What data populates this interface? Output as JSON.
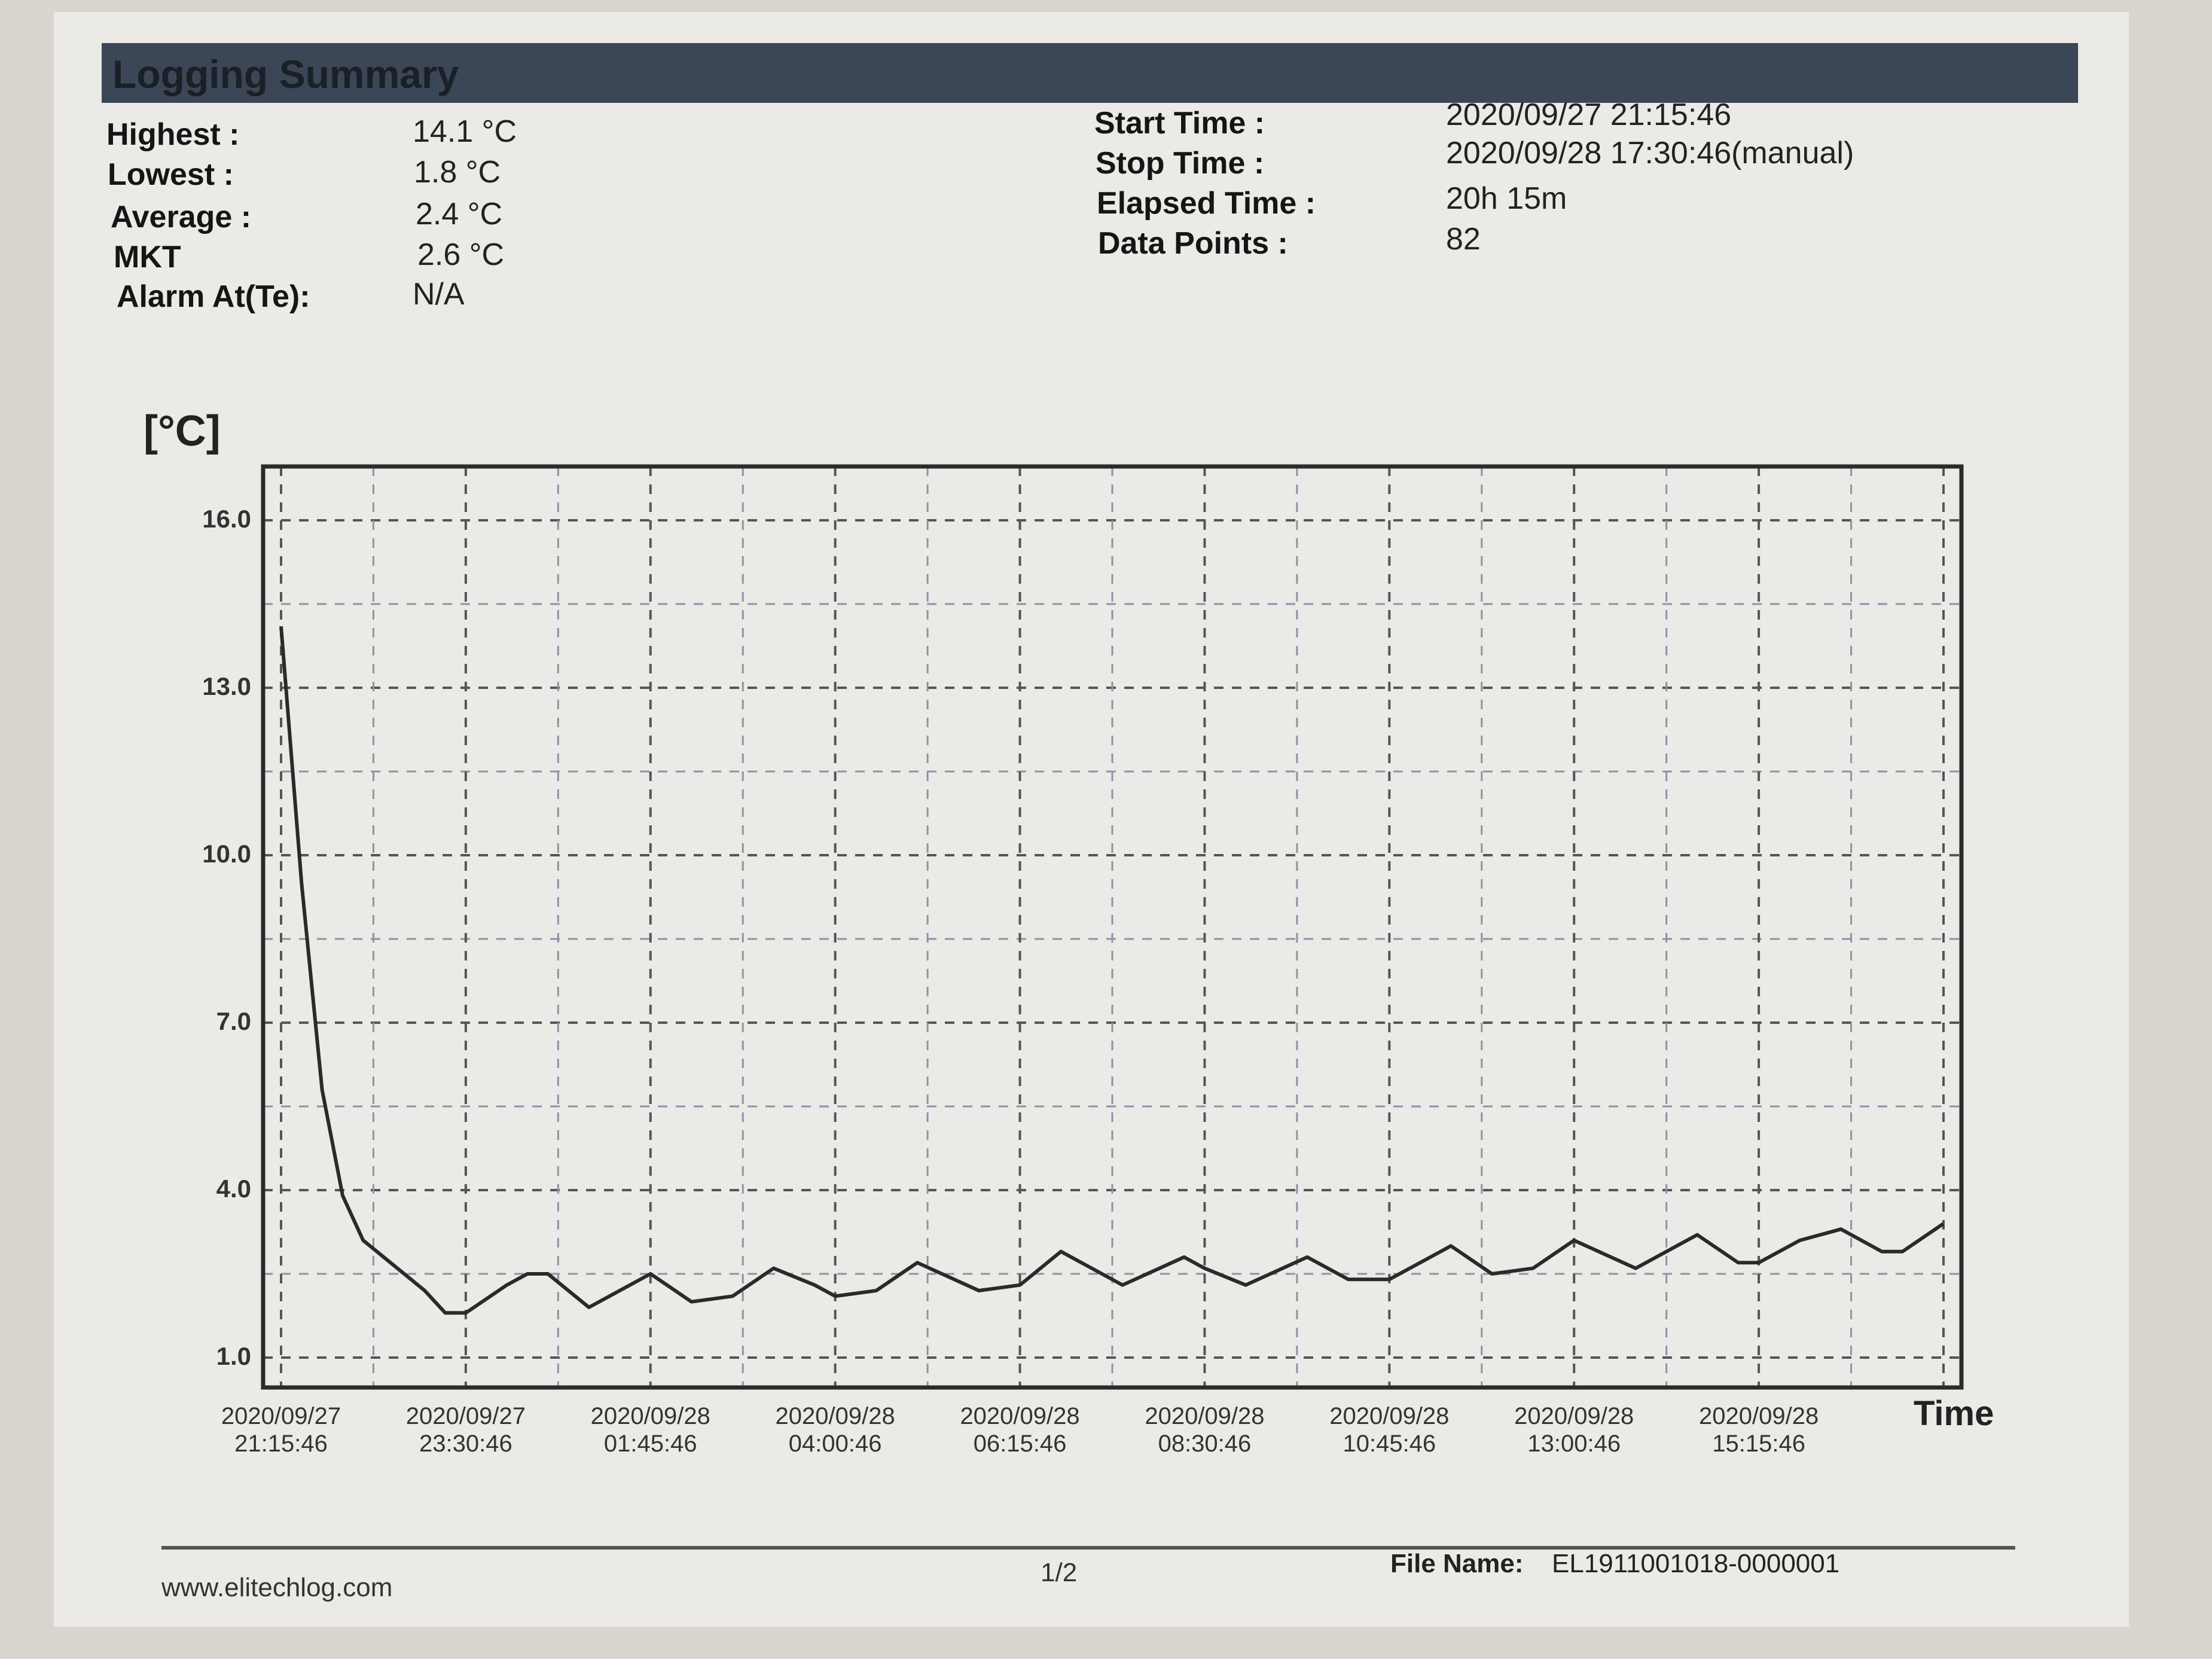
{
  "report": {
    "title": "Logging Summary",
    "stats": [
      {
        "label": "Highest :",
        "value": "14.1 °C"
      },
      {
        "label": "Lowest :",
        "value": "1.8 °C"
      },
      {
        "label": "Average :",
        "value": "2.4 °C"
      },
      {
        "label": "MKT",
        "value": "2.6 °C"
      },
      {
        "label": "Alarm At(Te):",
        "value": "N/A"
      }
    ],
    "meta": [
      {
        "label": "Start Time :",
        "value": "2020/09/27 21:15:46"
      },
      {
        "label": "Stop Time :",
        "value": "2020/09/28 17:30:46(manual)"
      },
      {
        "label": "Elapsed Time :",
        "value": "20h 15m"
      },
      {
        "label": "Data Points :",
        "value": "82"
      }
    ]
  },
  "chart_data": {
    "type": "line",
    "ylabel": "[°C]",
    "xlabel": "Time",
    "ylim": [
      1.0,
      16.0
    ],
    "yticks": [
      "16.0",
      "13.0",
      "10.0",
      "7.0",
      "4.0",
      "1.0"
    ],
    "xticks": [
      {
        "date": "2020/09/27",
        "time": "21:15:46"
      },
      {
        "date": "2020/09/27",
        "time": "23:30:46"
      },
      {
        "date": "2020/09/28",
        "time": "01:45:46"
      },
      {
        "date": "2020/09/28",
        "time": "04:00:46"
      },
      {
        "date": "2020/09/28",
        "time": "06:15:46"
      },
      {
        "date": "2020/09/28",
        "time": "08:30:46"
      },
      {
        "date": "2020/09/28",
        "time": "10:45:46"
      },
      {
        "date": "2020/09/28",
        "time": "13:00:46"
      },
      {
        "date": "2020/09/28",
        "time": "15:15:46"
      }
    ],
    "grid": true,
    "series": [
      {
        "color": "#2a2a2a",
        "points": [
          [
            "2020/09/27 21:15:46",
            14.1
          ],
          [
            "2020/09/27 21:30:46",
            9.5
          ],
          [
            "2020/09/27 21:45:46",
            5.8
          ],
          [
            "2020/09/27 22:00:46",
            3.9
          ],
          [
            "2020/09/27 22:15:46",
            3.1
          ],
          [
            "2020/09/27 22:30:46",
            2.8
          ],
          [
            "2020/09/27 23:00:46",
            2.2
          ],
          [
            "2020/09/27 23:15:46",
            1.8
          ],
          [
            "2020/09/27 23:30:46",
            1.8
          ],
          [
            "2020/09/28 00:00:46",
            2.3
          ],
          [
            "2020/09/28 00:15:46",
            2.5
          ],
          [
            "2020/09/28 00:30:46",
            2.5
          ],
          [
            "2020/09/28 01:00:46",
            1.9
          ],
          [
            "2020/09/28 01:45:46",
            2.5
          ],
          [
            "2020/09/28 02:15:46",
            2.0
          ],
          [
            "2020/09/28 02:45:46",
            2.1
          ],
          [
            "2020/09/28 03:15:46",
            2.6
          ],
          [
            "2020/09/28 03:45:46",
            2.3
          ],
          [
            "2020/09/28 04:00:46",
            2.1
          ],
          [
            "2020/09/28 04:30:46",
            2.2
          ],
          [
            "2020/09/28 05:00:46",
            2.7
          ],
          [
            "2020/09/28 05:45:46",
            2.2
          ],
          [
            "2020/09/28 06:15:46",
            2.3
          ],
          [
            "2020/09/28 06:45:46",
            2.9
          ],
          [
            "2020/09/28 07:30:46",
            2.3
          ],
          [
            "2020/09/28 08:15:46",
            2.8
          ],
          [
            "2020/09/28 08:30:46",
            2.6
          ],
          [
            "2020/09/28 09:00:46",
            2.3
          ],
          [
            "2020/09/28 09:45:46",
            2.8
          ],
          [
            "2020/09/28 10:15:46",
            2.4
          ],
          [
            "2020/09/28 10:45:46",
            2.4
          ],
          [
            "2020/09/28 11:30:46",
            3.0
          ],
          [
            "2020/09/28 12:00:46",
            2.5
          ],
          [
            "2020/09/28 12:30:46",
            2.6
          ],
          [
            "2020/09/28 13:00:46",
            3.1
          ],
          [
            "2020/09/28 13:45:46",
            2.6
          ],
          [
            "2020/09/28 14:30:46",
            3.2
          ],
          [
            "2020/09/28 15:00:46",
            2.7
          ],
          [
            "2020/09/28 15:15:46",
            2.7
          ],
          [
            "2020/09/28 15:45:46",
            3.1
          ],
          [
            "2020/09/28 16:15:46",
            3.3
          ],
          [
            "2020/09/28 16:45:46",
            2.9
          ],
          [
            "2020/09/28 17:00:46",
            2.9
          ],
          [
            "2020/09/28 17:30:46",
            3.4
          ]
        ]
      }
    ]
  },
  "footer": {
    "url": "www.elitechlog.com",
    "page": "1/2",
    "file_label": "File Name:",
    "file_name": "EL1911001018-0000001"
  }
}
